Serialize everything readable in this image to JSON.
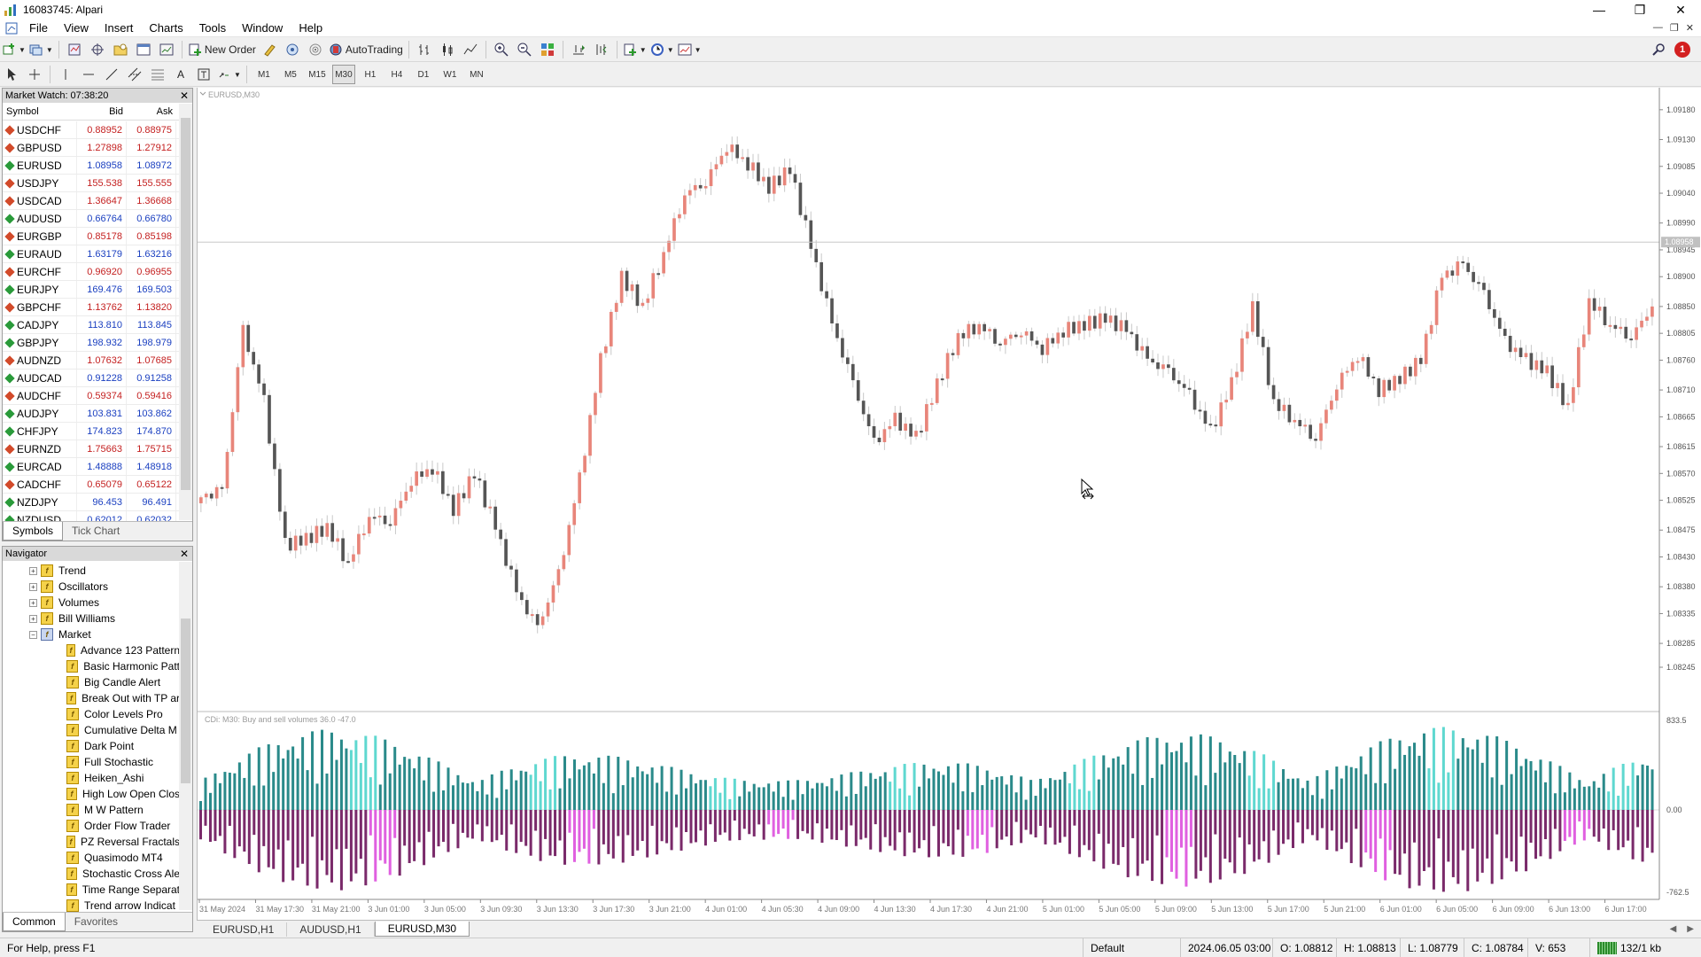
{
  "window": {
    "title": "16083745: Alpari"
  },
  "menu": [
    "File",
    "View",
    "Insert",
    "Charts",
    "Tools",
    "Window",
    "Help"
  ],
  "toolbar": {
    "new_order": "New Order",
    "auto_trading": "AutoTrading",
    "timeframes": [
      "M1",
      "M5",
      "M15",
      "M30",
      "H1",
      "H4",
      "D1",
      "W1",
      "MN"
    ],
    "active_timeframe": "M30",
    "notification_count": "1"
  },
  "market_watch": {
    "title": "Market Watch: 07:38:20",
    "columns": {
      "symbol": "Symbol",
      "bid": "Bid",
      "ask": "Ask"
    },
    "rows": [
      {
        "symbol": "USDCHF",
        "bid": "0.88952",
        "ask": "0.88975",
        "dir": "down"
      },
      {
        "symbol": "GBPUSD",
        "bid": "1.27898",
        "ask": "1.27912",
        "dir": "down"
      },
      {
        "symbol": "EURUSD",
        "bid": "1.08958",
        "ask": "1.08972",
        "dir": "up"
      },
      {
        "symbol": "USDJPY",
        "bid": "155.538",
        "ask": "155.555",
        "dir": "down"
      },
      {
        "symbol": "USDCAD",
        "bid": "1.36647",
        "ask": "1.36668",
        "dir": "down"
      },
      {
        "symbol": "AUDUSD",
        "bid": "0.66764",
        "ask": "0.66780",
        "dir": "up"
      },
      {
        "symbol": "EURGBP",
        "bid": "0.85178",
        "ask": "0.85198",
        "dir": "down"
      },
      {
        "symbol": "EURAUD",
        "bid": "1.63179",
        "ask": "1.63216",
        "dir": "up"
      },
      {
        "symbol": "EURCHF",
        "bid": "0.96920",
        "ask": "0.96955",
        "dir": "down"
      },
      {
        "symbol": "EURJPY",
        "bid": "169.476",
        "ask": "169.503",
        "dir": "up"
      },
      {
        "symbol": "GBPCHF",
        "bid": "1.13762",
        "ask": "1.13820",
        "dir": "down"
      },
      {
        "symbol": "CADJPY",
        "bid": "113.810",
        "ask": "113.845",
        "dir": "up"
      },
      {
        "symbol": "GBPJPY",
        "bid": "198.932",
        "ask": "198.979",
        "dir": "up"
      },
      {
        "symbol": "AUDNZD",
        "bid": "1.07632",
        "ask": "1.07685",
        "dir": "down"
      },
      {
        "symbol": "AUDCAD",
        "bid": "0.91228",
        "ask": "0.91258",
        "dir": "up"
      },
      {
        "symbol": "AUDCHF",
        "bid": "0.59374",
        "ask": "0.59416",
        "dir": "down"
      },
      {
        "symbol": "AUDJPY",
        "bid": "103.831",
        "ask": "103.862",
        "dir": "up"
      },
      {
        "symbol": "CHFJPY",
        "bid": "174.823",
        "ask": "174.870",
        "dir": "up"
      },
      {
        "symbol": "EURNZD",
        "bid": "1.75663",
        "ask": "1.75715",
        "dir": "down"
      },
      {
        "symbol": "EURCAD",
        "bid": "1.48888",
        "ask": "1.48918",
        "dir": "up"
      },
      {
        "symbol": "CADCHF",
        "bid": "0.65079",
        "ask": "0.65122",
        "dir": "down"
      },
      {
        "symbol": "NZDJPY",
        "bid": "96.453",
        "ask": "96.491",
        "dir": "up"
      },
      {
        "symbol": "NZDUSD",
        "bid": "0.62012",
        "ask": "0.62032",
        "dir": "up"
      }
    ],
    "tabs": [
      "Symbols",
      "Tick Chart"
    ]
  },
  "navigator": {
    "title": "Navigator",
    "folders": [
      "Trend",
      "Oscillators",
      "Volumes",
      "Bill Williams",
      "Market"
    ],
    "market_items": [
      "Advance 123 Pattern",
      "Basic Harmonic Patt",
      "Big Candle Alert",
      "Break Out with TP ar",
      "Color Levels Pro",
      "Cumulative Delta M",
      "Dark Point",
      "Full Stochastic",
      "Heiken_Ashi",
      "High Low Open Clos",
      "M W Pattern",
      "Order Flow Trader",
      "PZ Reversal Fractals",
      "Quasimodo MT4",
      "Stochastic Cross Ale",
      "Time Range Separat",
      "Trend arrow Indicat"
    ],
    "tabs": [
      "Common",
      "Favorites"
    ]
  },
  "chart": {
    "label": "EURUSD,M30",
    "indicator_label": "CDi: M30: Buy and sell volumes  36.0 -47.0",
    "current_price": "1.08958",
    "colors": {
      "bull": "#e8857a",
      "bear": "#555555",
      "buy": "#2a8a8a",
      "sell": "#7a2a6a",
      "buy_hi": "#5fd8d0",
      "sell_hi": "#e060e0"
    }
  },
  "chart_data": {
    "type": "candlestick",
    "symbol": "EURUSD",
    "timeframe": "M30",
    "price_axis": [
      "1.09180",
      "1.09130",
      "1.09085",
      "1.09040",
      "1.08990",
      "1.08945",
      "1.08900",
      "1.08850",
      "1.08805",
      "1.08760",
      "1.08710",
      "1.08665",
      "1.08615",
      "1.08570",
      "1.08525",
      "1.08475",
      "1.08430",
      "1.08380",
      "1.08335",
      "1.08285",
      "1.08245"
    ],
    "ylim": [
      1.08245,
      1.09205
    ],
    "indicator_axis": [
      "833.5",
      "0.00",
      "-762.5"
    ],
    "x_labels": [
      "31 May 2024",
      "31 May 17:30",
      "31 May 21:00",
      "3 Jun 01:00",
      "3 Jun 05:00",
      "3 Jun 09:30",
      "3 Jun 13:30",
      "3 Jun 17:30",
      "3 Jun 21:00",
      "4 Jun 01:00",
      "4 Jun 05:30",
      "4 Jun 09:00",
      "4 Jun 13:30",
      "4 Jun 17:30",
      "4 Jun 21:00",
      "5 Jun 01:00",
      "5 Jun 05:00",
      "5 Jun 09:00",
      "5 Jun 13:00",
      "5 Jun 17:00",
      "5 Jun 21:00",
      "6 Jun 01:00",
      "6 Jun 05:00",
      "6 Jun 09:00",
      "6 Jun 13:00",
      "6 Jun 17:00"
    ],
    "closes": [
      1.0853,
      1.0854,
      1.0881,
      1.0869,
      1.0845,
      1.0846,
      1.0848,
      1.0842,
      1.085,
      1.0849,
      1.0856,
      1.0858,
      1.0851,
      1.0857,
      1.0848,
      1.0837,
      1.0831,
      1.084,
      1.0856,
      1.0876,
      1.089,
      1.0885,
      1.0894,
      1.0904,
      1.0906,
      1.0912,
      1.0909,
      1.0905,
      1.0908,
      1.0895,
      1.0882,
      1.0872,
      1.0862,
      1.0866,
      1.0863,
      1.0872,
      1.088,
      1.0882,
      1.0879,
      1.0881,
      1.0878,
      1.0881,
      1.0882,
      1.0883,
      1.0881,
      1.0876,
      1.0874,
      1.087,
      1.0864,
      1.0872,
      1.0885,
      1.0869,
      1.0866,
      1.0863,
      1.0872,
      1.0877,
      1.0871,
      1.0873,
      1.0876,
      1.089,
      1.0892,
      1.0887,
      1.0879,
      1.0876,
      1.0874,
      1.0868,
      1.0886,
      1.0882,
      1.088,
      1.0885
    ]
  },
  "chart_tabs": [
    "EURUSD,H1",
    "AUDUSD,H1",
    "EURUSD,M30"
  ],
  "active_chart_tab": "EURUSD,M30",
  "status": {
    "help": "For Help, press F1",
    "profile": "Default",
    "time": "2024.06.05 03:00",
    "open": "O: 1.08812",
    "high": "H: 1.08813",
    "low": "L: 1.08779",
    "close": "C: 1.08784",
    "volume": "V: 653",
    "connection": "132/1 kb"
  }
}
